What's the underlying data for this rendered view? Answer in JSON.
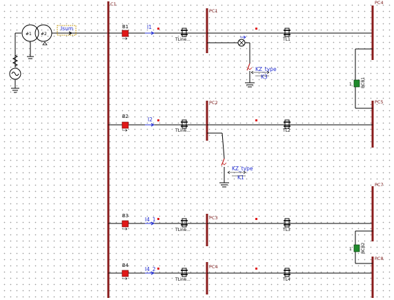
{
  "buses": [
    {
      "id": "c1",
      "label": "C1"
    },
    {
      "id": "pc1",
      "label": "PC1"
    },
    {
      "id": "pc2",
      "label": "PC2"
    },
    {
      "id": "pc3",
      "label": "PC3"
    },
    {
      "id": "pc4",
      "label": "PC4"
    },
    {
      "id": "pc5",
      "label": "PC5"
    },
    {
      "id": "pc6",
      "label": "PC6"
    },
    {
      "id": "pc7",
      "label": "PC7"
    },
    {
      "id": "pc8",
      "label": "PC8"
    }
  ],
  "transformer": {
    "winding1": "#1",
    "winding2": "#2",
    "meter": "Isum"
  },
  "breakers": [
    "B1",
    "B2",
    "B3",
    "B4"
  ],
  "meters": [
    "I1",
    "I2",
    "I4_1",
    "I4_2"
  ],
  "line_labels": [
    "TLine...",
    "TLine...",
    "TLine...",
    "TLine...",
    "TL1",
    "TL2",
    "TL3",
    "TL4"
  ],
  "faults": [
    {
      "switch": "K3",
      "type": "KZ_type"
    },
    {
      "switch": "K1",
      "type": "KZ_type"
    }
  ],
  "couplers": [
    {
      "label": "BCB1",
      "tag": "1"
    },
    {
      "label": "BCB2",
      "tag": "1"
    }
  ],
  "colors": {
    "bus": "#8a1c1c",
    "breaker": "#e01818",
    "coupler": "#1f8a2c",
    "meter_text": "#1f2bd0",
    "wire": "#000000"
  }
}
